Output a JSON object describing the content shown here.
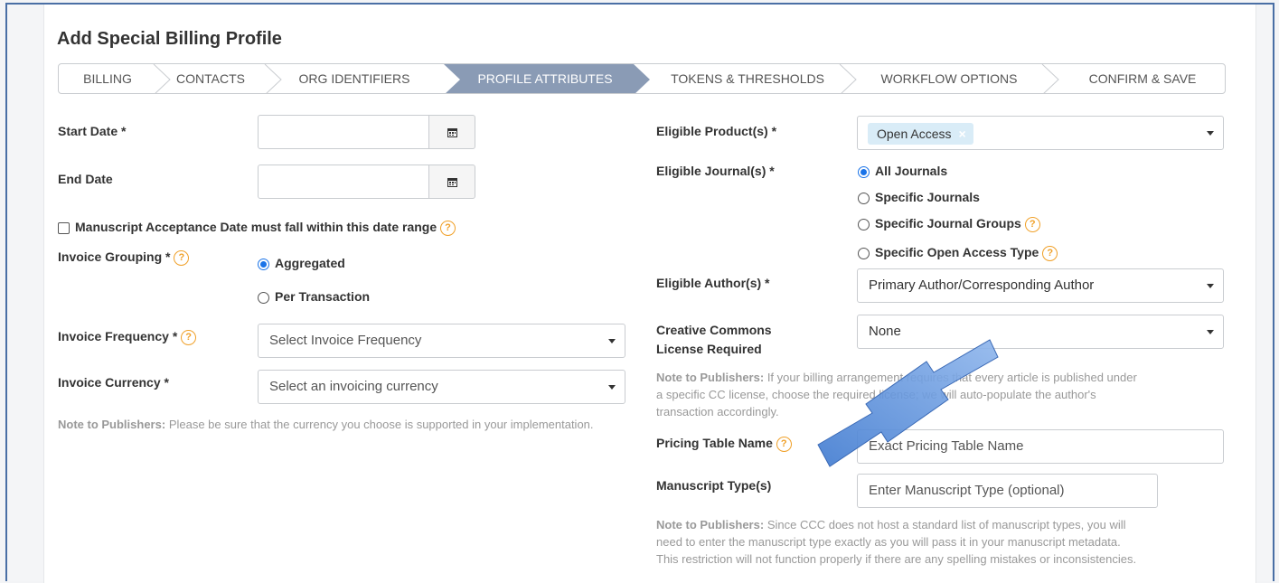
{
  "page_title": "Add Special Billing Profile",
  "steps": [
    "BILLING",
    "CONTACTS",
    "ORG IDENTIFIERS",
    "PROFILE ATTRIBUTES",
    "TOKENS & THRESHOLDS",
    "WORKFLOW OPTIONS",
    "CONFIRM & SAVE"
  ],
  "active_step_index": 3,
  "colors": {
    "active_step": "#8a9bb5",
    "accent_help": "#f0a028",
    "radio_on": "#1a73e8",
    "arrow": "#5b8fd6"
  },
  "left": {
    "start_date_label": "Start Date *",
    "end_date_label": "End Date",
    "manuscript_acceptance_label": "Manuscript Acceptance Date must fall within this date range",
    "invoice_grouping_label": "Invoice Grouping *",
    "grouping_options": [
      "Aggregated",
      "Per Transaction"
    ],
    "invoice_frequency_label": "Invoice Frequency *",
    "invoice_frequency_placeholder": "Select Invoice Frequency",
    "invoice_currency_label": "Invoice Currency *",
    "invoice_currency_placeholder": "Select an invoicing currency",
    "note_bold": "Note to Publishers:",
    "note_text": "Please be sure that the currency you choose is supported in your implementation."
  },
  "right": {
    "eligible_products_label": "Eligible Product(s) *",
    "eligible_products_tag": "Open Access",
    "eligible_journals_label": "Eligible Journal(s) *",
    "journal_options": [
      "All Journals",
      "Specific Journals",
      "Specific Journal Groups",
      "Specific Open Access Type"
    ],
    "eligible_authors_label": "Eligible Author(s) *",
    "eligible_authors_value": "Primary Author/Corresponding Author",
    "cc_label_line1": "Creative Commons",
    "cc_label_line2": "License Required",
    "cc_value": "None",
    "cc_note_bold": "Note to Publishers:",
    "cc_note_line1": "If your billing arrangement requires that every article is published under",
    "cc_note_line2": "a specific CC license, choose the required license; we will auto-populate the author's",
    "cc_note_line3": "transaction accordingly.",
    "pricing_table_label": "Pricing Table Name",
    "pricing_table_placeholder": "Exact Pricing Table Name",
    "manuscript_type_label": "Manuscript Type(s)",
    "manuscript_type_placeholder": "Enter Manuscript Type (optional)",
    "mt_note_bold": "Note to Publishers:",
    "mt_note_line1": "Since CCC does not host a standard list of manuscript types, you will",
    "mt_note_line2": "need to enter the manuscript type exactly as you will pass it in your manuscript metadata.",
    "mt_note_line3": "This restriction will not function properly if there are any spelling mistakes or inconsistencies."
  }
}
